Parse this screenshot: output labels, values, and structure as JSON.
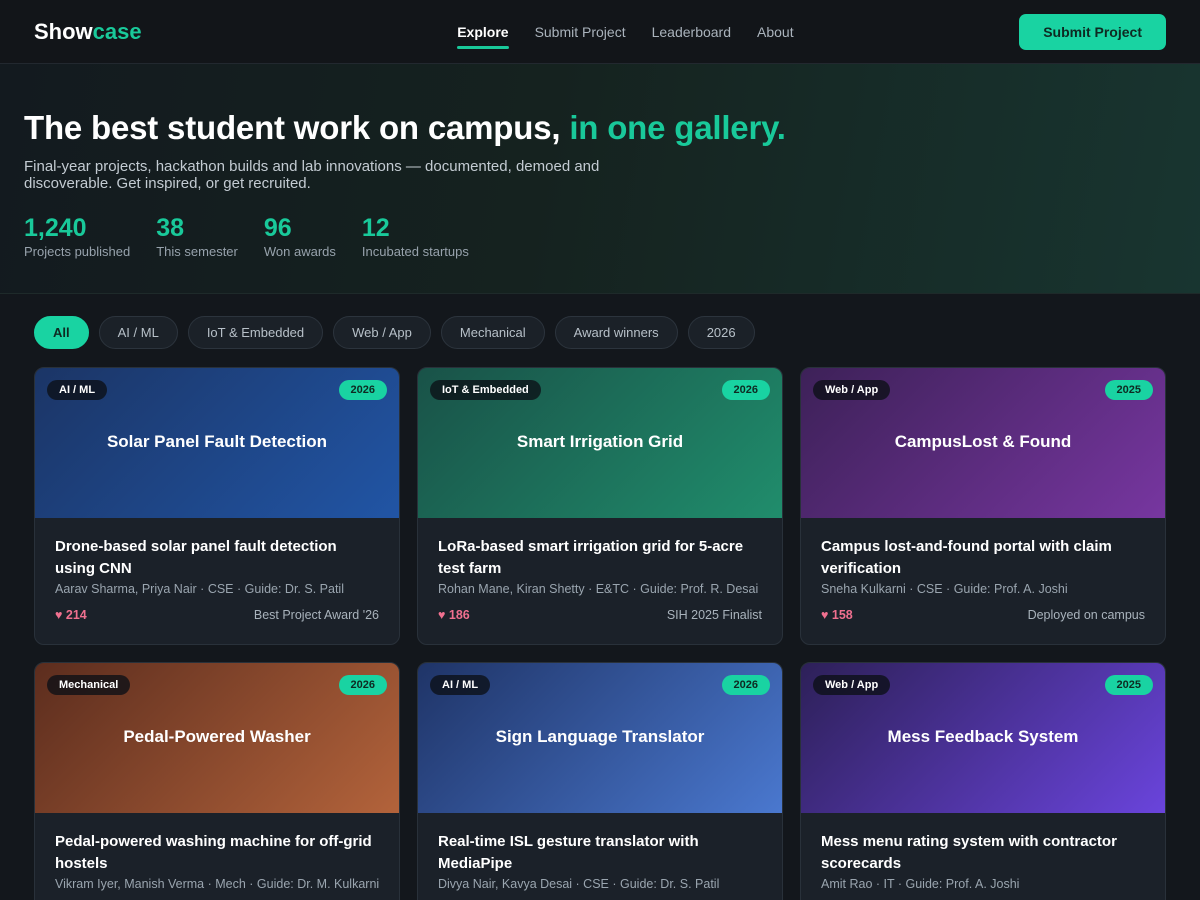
{
  "nav": {
    "logo_main": "Show",
    "logo_accent": "case",
    "links": [
      "Explore",
      "Submit Project",
      "Leaderboard",
      "About"
    ],
    "cta": "Submit Project"
  },
  "hero": {
    "title_main": "The best student work on campus,",
    "title_accent": "in one gallery.",
    "subtitle": "Final-year projects, hackathon builds and lab innovations — documented, demoed and discoverable. Get inspired, or get recruited.",
    "stats": [
      {
        "value": "1,240",
        "label": "Projects published"
      },
      {
        "value": "38",
        "label": "This semester"
      },
      {
        "value": "96",
        "label": "Won awards"
      },
      {
        "value": "12",
        "label": "Incubated startups"
      }
    ]
  },
  "filters": [
    "All",
    "AI / ML",
    "IoT & Embedded",
    "Web / App",
    "Mechanical",
    "Award winners",
    "2026"
  ],
  "projects": [
    {
      "tag": "AI / ML",
      "year": "2026",
      "banner": "Solar Panel Fault Detection",
      "title": "Drone-based solar panel fault detection using CNN",
      "meta": "Aarav Sharma, Priya Nair · CSE · Guide: Dr. S. Patil",
      "likes": "♥ 214",
      "award": "Best Project Award '26",
      "theme": "g-blue"
    },
    {
      "tag": "IoT & Embedded",
      "year": "2026",
      "banner": "Smart Irrigation Grid",
      "title": "LoRa-based smart irrigation grid for 5-acre test farm",
      "meta": "Rohan Mane, Kiran Shetty · E&TC · Guide: Prof. R. Desai",
      "likes": "♥ 186",
      "award": "SIH 2025 Finalist",
      "theme": "g-green"
    },
    {
      "tag": "Web / App",
      "year": "2025",
      "banner": "CampusLost & Found",
      "title": "Campus lost-and-found portal with claim verification",
      "meta": "Sneha Kulkarni · CSE · Guide: Prof. A. Joshi",
      "likes": "♥ 158",
      "award": "Deployed on campus",
      "theme": "g-purple"
    },
    {
      "tag": "Mechanical",
      "year": "2026",
      "banner": "Pedal-Powered Washer",
      "title": "Pedal-powered washing machine for off-grid hostels",
      "meta": "Vikram Iyer, Manish Verma · Mech · Guide: Dr. M. Kulkarni",
      "likes": "",
      "award": "",
      "theme": "g-orange"
    },
    {
      "tag": "AI / ML",
      "year": "2026",
      "banner": "Sign Language Translator",
      "title": "Real-time ISL gesture translator with MediaPipe",
      "meta": "Divya Nair, Kavya Desai · CSE · Guide: Dr. S. Patil",
      "likes": "",
      "award": "",
      "theme": "g-blue2"
    },
    {
      "tag": "Web / App",
      "year": "2025",
      "banner": "Mess Feedback System",
      "title": "Mess menu rating system with contractor scorecards",
      "meta": "Amit Rao · IT · Guide: Prof. A. Joshi",
      "likes": "",
      "award": "",
      "theme": "g-violet"
    }
  ]
}
